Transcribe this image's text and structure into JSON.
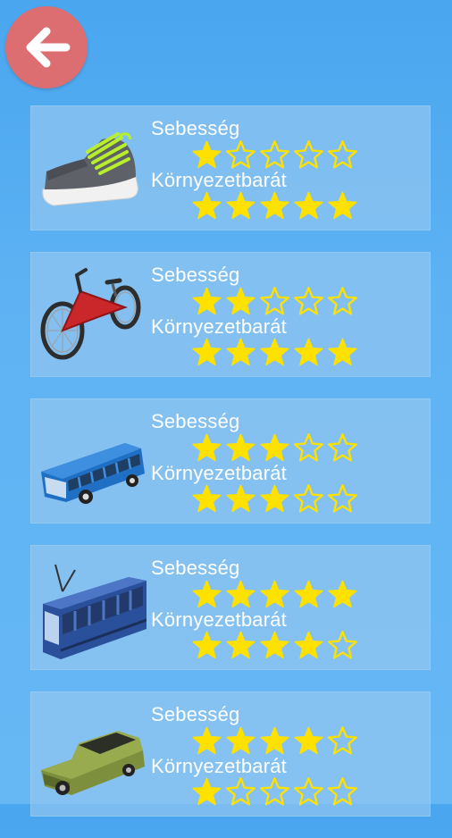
{
  "back_button": {
    "icon": "arrow-left-icon"
  },
  "labels": {
    "speed": "Sebesség",
    "eco": "Környezetbarát"
  },
  "colors": {
    "star_fill": "#ffe100",
    "back_button": "#dc6e72"
  },
  "vehicles": [
    {
      "icon": "sneaker-icon",
      "speed_rating": 1,
      "eco_rating": 5,
      "max_rating": 5
    },
    {
      "icon": "bicycle-icon",
      "speed_rating": 2,
      "eco_rating": 5,
      "max_rating": 5
    },
    {
      "icon": "bus-icon",
      "speed_rating": 3,
      "eco_rating": 3,
      "max_rating": 5
    },
    {
      "icon": "tram-icon",
      "speed_rating": 5,
      "eco_rating": 4,
      "max_rating": 5
    },
    {
      "icon": "car-icon",
      "speed_rating": 4,
      "eco_rating": 1,
      "max_rating": 5
    }
  ]
}
